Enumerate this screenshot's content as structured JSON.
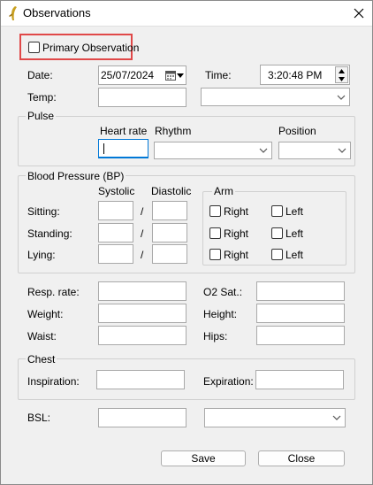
{
  "window": {
    "title": "Observations"
  },
  "primary": {
    "label": "Primary Observation"
  },
  "date": {
    "label": "Date:",
    "value": "25/07/2024"
  },
  "time": {
    "label": "Time:",
    "value": "3:20:48 PM"
  },
  "temp": {
    "label": "Temp:"
  },
  "pulse": {
    "title": "Pulse",
    "heart_rate": "Heart rate",
    "rhythm": "Rhythm",
    "position": "Position"
  },
  "bp": {
    "title": "Blood Pressure (BP)",
    "systolic": "Systolic",
    "diastolic": "Diastolic",
    "arm": "Arm",
    "sep": "/",
    "rows": [
      {
        "label": "Sitting:"
      },
      {
        "label": "Standing:"
      },
      {
        "label": "Lying:"
      }
    ],
    "right": "Right",
    "left": "Left"
  },
  "vitals": {
    "resp_rate": "Resp. rate:",
    "o2_sat": "O2 Sat.:",
    "weight": "Weight:",
    "height": "Height:",
    "waist": "Waist:",
    "hips": "Hips:"
  },
  "chest": {
    "title": "Chest",
    "inspiration": "Inspiration:",
    "expiration": "Expiration:"
  },
  "bsl": {
    "label": "BSL:"
  },
  "buttons": {
    "save": "Save",
    "close": "Close"
  },
  "colors": {
    "highlight": "#e04848",
    "field_border": "#a9a9a9",
    "focus_border": "#0078d7"
  }
}
